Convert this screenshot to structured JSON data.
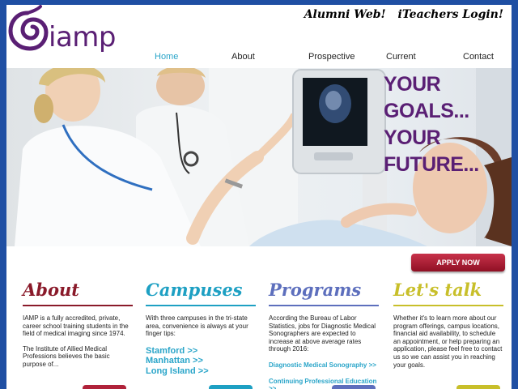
{
  "brand": {
    "logo_text": "iamp",
    "purple": "#5a1f74"
  },
  "top_links": {
    "alumni": "Alumni Web!",
    "teachers": "iTeachers Login!"
  },
  "nav": {
    "items": [
      "Home",
      "About",
      "Prospective",
      "Current",
      "Contact"
    ],
    "active": "Home",
    "active_color": "#2aa5c9"
  },
  "hero": {
    "line1": "YOUR GOALS...",
    "line2": "YOUR FUTURE..."
  },
  "apply": {
    "label": "APPLY NOW",
    "color": "#b0223a"
  },
  "columns": {
    "about": {
      "title": "About",
      "color": "#8a1a2a",
      "p1": "IAMP is a fully accredited, private, career school training students in the field of medical imaging since 1974.",
      "p2": "The Institute of Allied Medical Professions believes the basic purpose of..."
    },
    "campuses": {
      "title": "Campuses",
      "color": "#1ea0c3",
      "text": "With three campuses in the tri-state area, convenience is always at your finger tips:",
      "links": [
        "Stamford >>",
        "Manhattan >>",
        "Long Island >>"
      ]
    },
    "programs": {
      "title": "Programs",
      "color": "#5d6fbd",
      "text": "According the Bureau of Labor Statistics, jobs for Diagnostic Medical Sonographers are expected to increase at above average rates through 2016:",
      "links": [
        "Diagnostic Medical Sonography >>",
        "Continuing Professional Education >>"
      ]
    },
    "talk": {
      "title": "Let's talk",
      "color": "#c8bf2a",
      "text": "Whether it's to learn more about our program offerings, campus locations, financial aid availability, to schedule an appointment, or help preparing an application, please feel free to contact us so we can assist you in reaching your goals."
    }
  }
}
